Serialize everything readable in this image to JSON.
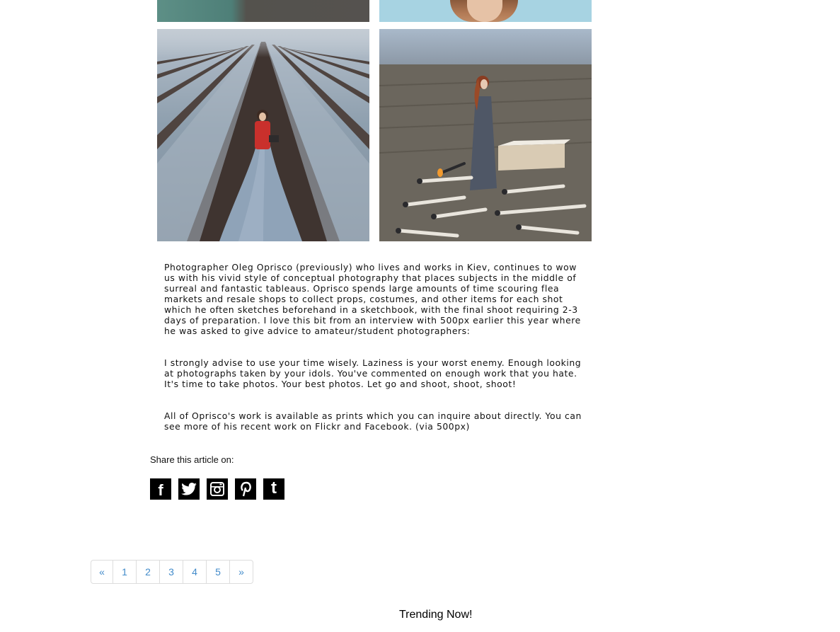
{
  "photos": {
    "top_left": "field-photo-partial",
    "top_right": "portrait-photo-partial",
    "field": "woman-in-red-field-photo",
    "matches": "woman-with-giant-matches-photo"
  },
  "article": {
    "paragraphs": [
      "Photographer Oleg Oprisco (previously) who lives and works in Kiev, continues to wow us with his vivid style of conceptual photography that places subjects in the middle of surreal and fantastic tableaus. Oprisco spends large amounts of time scouring flea markets and resale shops to collect props, costumes, and other items for each shot which he often sketches beforehand in a sketchbook, with the final shoot requiring 2-3 days of preparation. I love this bit from an interview with 500px earlier this year where he was asked to give advice to amateur/student photographers:",
      "I strongly advise to use your time wisely. Laziness is your worst enemy. Enough looking at photographs taken by your idols. You've commented on enough work that you hate. It's time to take photos. Your best photos. Let go and shoot, shoot, shoot!",
      "All of Oprisco's work is available as prints which you can inquire about directly. You can see more of his recent work on Flickr and Facebook. (via 500px)"
    ]
  },
  "share": {
    "label": "Share this article on:",
    "icons": [
      "facebook-icon",
      "twitter-icon",
      "instagram-icon",
      "pinterest-icon",
      "tumblr-icon"
    ],
    "facebook_glyph": "f",
    "tumblr_glyph": "t"
  },
  "pagination": {
    "prev": "«",
    "pages": [
      "1",
      "2",
      "3",
      "4",
      "5"
    ],
    "next": "»",
    "link_color": "#428bca"
  },
  "trending": {
    "title": "Trending Now!"
  }
}
